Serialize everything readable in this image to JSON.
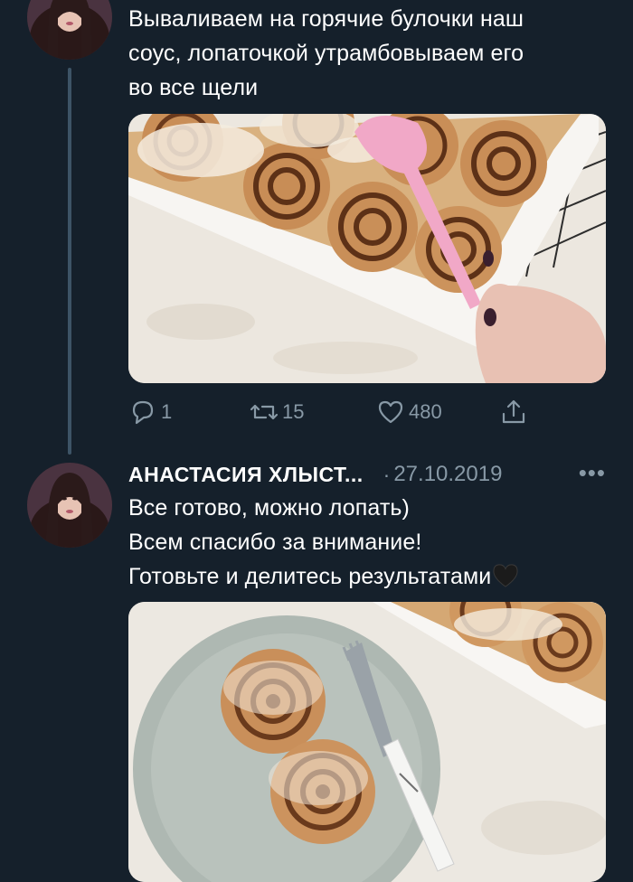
{
  "tweet1": {
    "text_lines": [
      "Вываливаем на горячие булочки наш",
      "соус, лопаточкой утрамбовываем его",
      "во все щели"
    ],
    "media_description_icon": "cinnamon-rolls-photo",
    "actions": {
      "reply_count": "1",
      "retweet_count": "15",
      "like_count": "480"
    }
  },
  "tweet2": {
    "author_name": "АНАСТАСИЯ ХЛЫСТ...",
    "separator": "·",
    "date": "27.10.2019",
    "more": "•••",
    "text_lines": [
      "Все готово, можно лопать)",
      "Всем спасибо за внимание!",
      "Готовьте и делитесь результатами"
    ],
    "emoji_icon": "black-heart-icon",
    "media_description_icon": "cinnamon-rolls-plate-photo"
  },
  "colors": {
    "background": "#15202b",
    "text": "#ffffff",
    "secondary": "#8899a6",
    "thread_line": "#3d5466"
  }
}
